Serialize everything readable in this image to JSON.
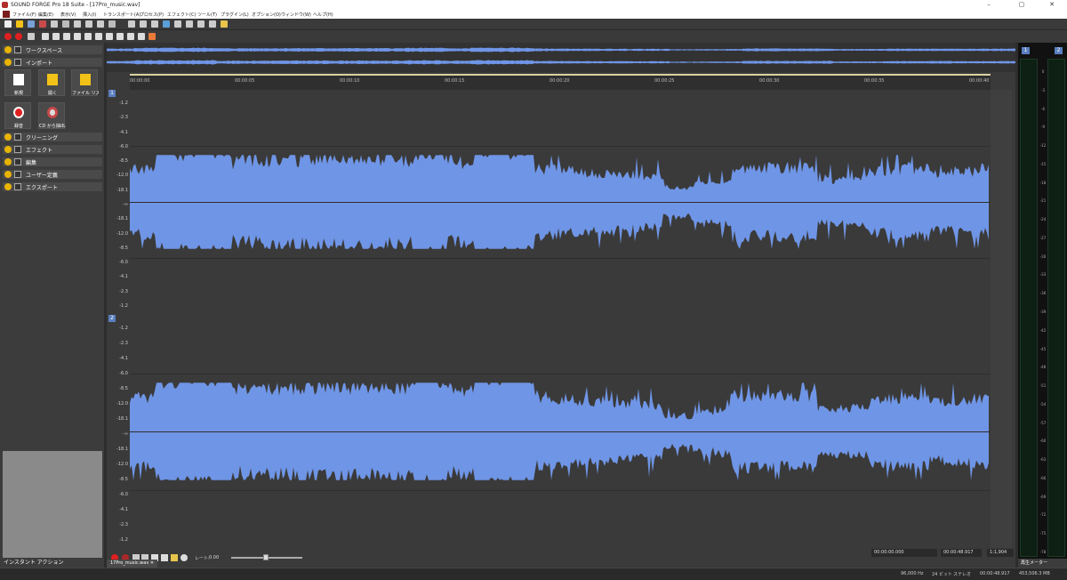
{
  "window": {
    "title": "SOUND FORGE Pro 18 Suite - [17Pro_music.wav]",
    "controls": [
      "–",
      "▢",
      "✕"
    ]
  },
  "menu": [
    "ファイル(F)",
    "編集(E)",
    "表示(V)",
    "挿入(I)",
    "トランスポート(A)",
    "プロセス(P)",
    "エフェクト(C)",
    "ツール(T)",
    "プラグイン(L)",
    "オプション(O)",
    "ウィンドウ(W)",
    "ヘルプ(H)"
  ],
  "left_panel": {
    "sections": {
      "workspace": "ワークスペース",
      "import": "インポート",
      "cleaning": "クリーニング",
      "effects": "エフェクト",
      "edit": "編集",
      "user_defined": "ユーザー定義",
      "export": "エクスポート"
    },
    "tiles": {
      "new": "新規",
      "open": "開く",
      "file_list": "ファイル リスト...",
      "record": "録音",
      "cd_extract": "CD から抽出..."
    },
    "bottom_tab": "インスタント アクション"
  },
  "ruler": [
    "00:00:00",
    "00:00:05",
    "00:00:10",
    "00:00:15",
    "00:00:20",
    "00:00:25",
    "00:00:30",
    "00:00:35",
    "00:00:40"
  ],
  "channels": [
    {
      "number": "1",
      "db_labels": [
        "-1.2",
        "-2.3",
        "-4.1",
        "-6.0",
        "-8.5",
        "-12.0",
        "-18.1",
        "-∞",
        "-18.1",
        "-12.0",
        "-8.5",
        "-6.0",
        "-4.1",
        "-2.3",
        "-1.2"
      ]
    },
    {
      "number": "2",
      "db_labels": [
        "-1.2",
        "-2.3",
        "-4.1",
        "-6.0",
        "-8.5",
        "-12.0",
        "-18.1",
        "-∞",
        "-18.1",
        "-12.0",
        "-8.5",
        "-6.0",
        "-4.1",
        "-2.3",
        "-1.2"
      ]
    }
  ],
  "transport": {
    "rate_label": "レート:",
    "rate_value": "0.00",
    "start_time": "00:00:00.000",
    "end_time": "00:00:48.917",
    "zoom": "1:1,904"
  },
  "file_tab": "17Pro_music.wav",
  "meter": {
    "channels": [
      "1",
      "2"
    ],
    "scale": [
      "0",
      "-3",
      "-6",
      "-9",
      "-12",
      "-15",
      "-18",
      "-21",
      "-24",
      "-27",
      "-30",
      "-33",
      "-36",
      "-39",
      "-42",
      "-45",
      "-48",
      "-51",
      "-54",
      "-57",
      "-60",
      "-63",
      "-66",
      "-69",
      "-72",
      "-75",
      "-78"
    ],
    "tab": "再生メーター"
  },
  "status": {
    "sample_rate": "96,000 Hz",
    "bit_depth": "24 ビット",
    "channels": "ステレオ",
    "length": "00:00:48.917",
    "size": "453,506.3 MB"
  },
  "colors": {
    "waveform": "#6f95e6",
    "accent": "#5a7fc0",
    "record": "#e02020",
    "folder": "#f2c218"
  }
}
